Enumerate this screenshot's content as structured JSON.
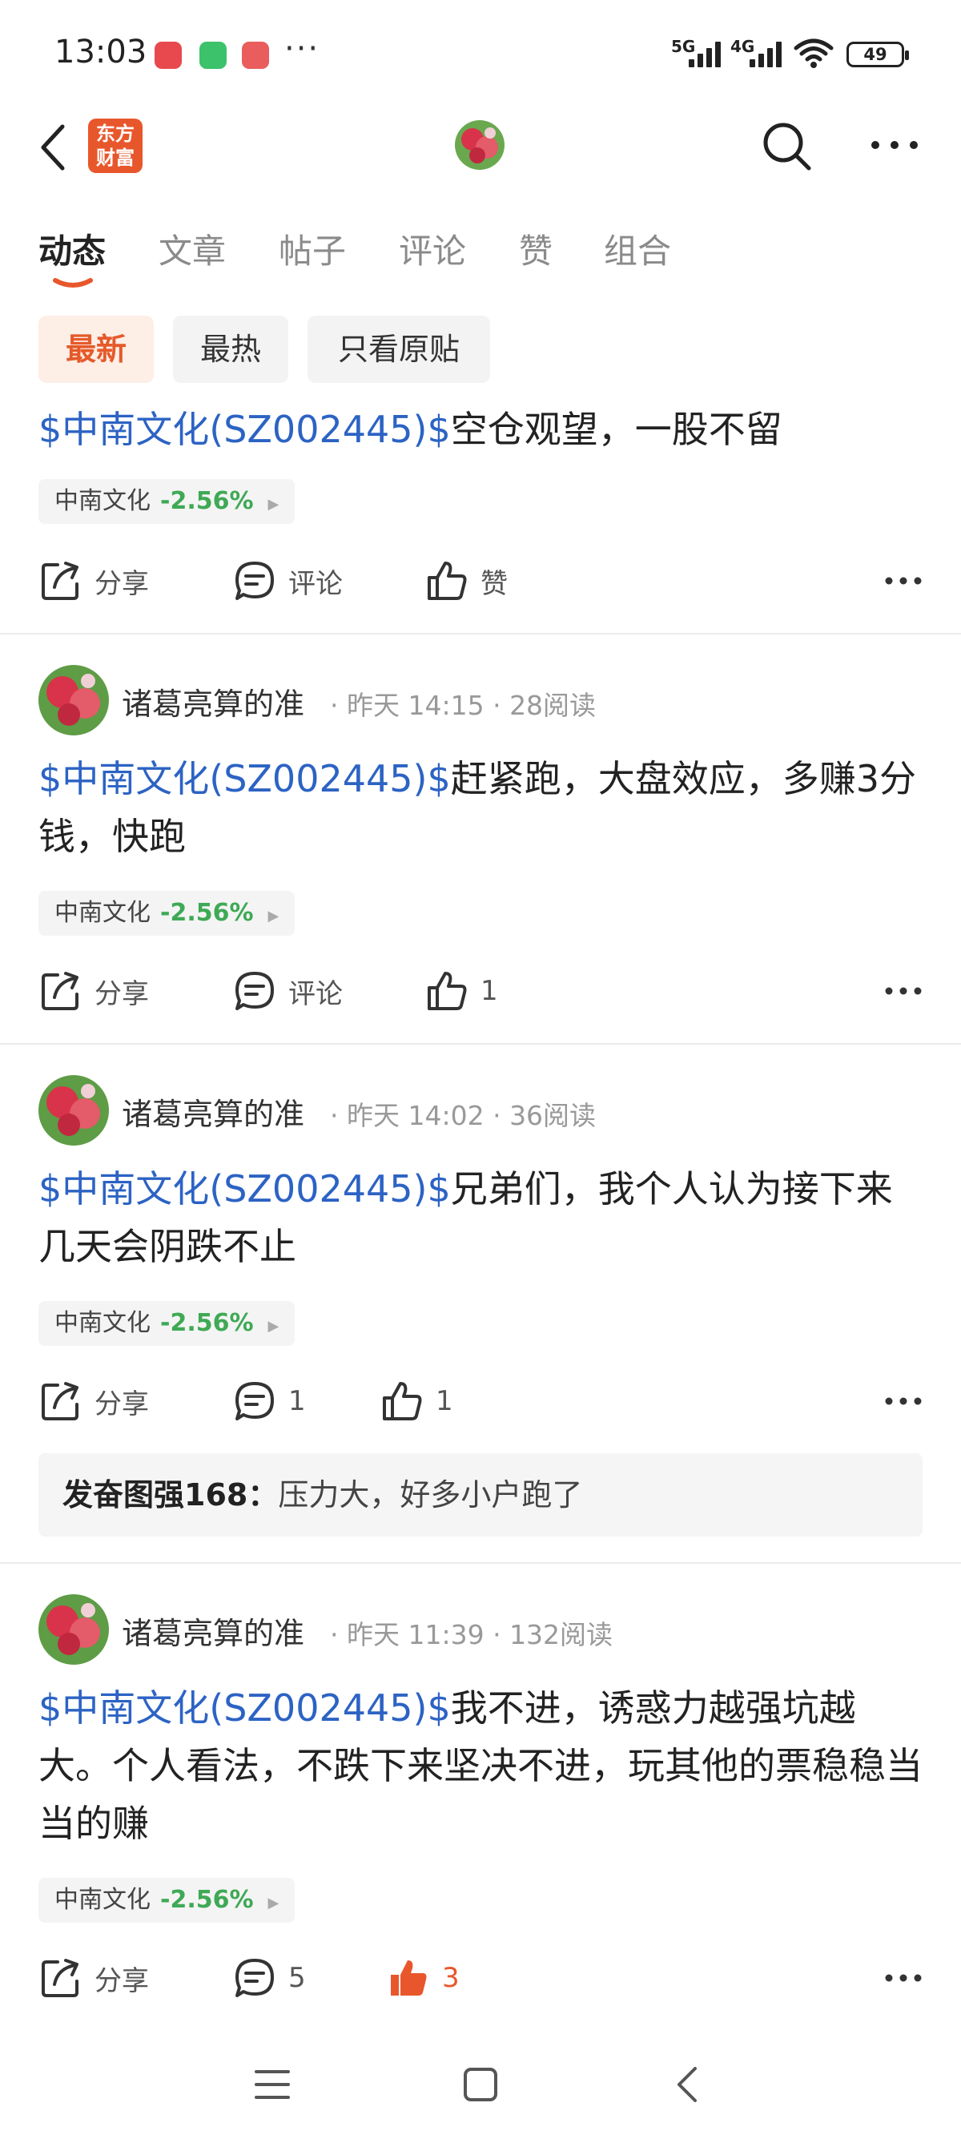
{
  "status_bar": {
    "time": "13:03",
    "more": "···",
    "net1": "5G",
    "net2": "4G",
    "battery": "49"
  },
  "header": {
    "logo_text_line1": "东方",
    "logo_text_line2": "财富",
    "back_icon": "chevron-left-icon",
    "search_icon": "search-icon",
    "more_icon": "more-horizontal-icon"
  },
  "tabs": [
    {
      "label": "动态",
      "active": true
    },
    {
      "label": "文章",
      "active": false
    },
    {
      "label": "帖子",
      "active": false
    },
    {
      "label": "评论",
      "active": false
    },
    {
      "label": "赞",
      "active": false
    },
    {
      "label": "组合",
      "active": false
    }
  ],
  "filters": [
    {
      "label": "最新",
      "active": true
    },
    {
      "label": "最热",
      "active": false
    },
    {
      "label": "只看原贴",
      "active": false
    }
  ],
  "accent_color": "#e8572c",
  "tag_color": "#2c63c4",
  "posts": [
    {
      "tag": "$中南文化(SZ002445)$",
      "text": "空仓观望，一股不留",
      "stock_name": "中南文化",
      "stock_change": "-2.56%",
      "share_label": "分享",
      "comment_label": "评论",
      "like_label": "赞"
    },
    {
      "author": "诸葛亮算的准",
      "time": "昨天 14:15",
      "reads": "28阅读",
      "tag": "$中南文化(SZ002445)$",
      "text": "赶紧跑，大盘效应，多赚3分钱，快跑",
      "stock_name": "中南文化",
      "stock_change": "-2.56%",
      "share_label": "分享",
      "comment_label": "评论",
      "like_label": "1"
    },
    {
      "author": "诸葛亮算的准",
      "time": "昨天 14:02",
      "reads": "36阅读",
      "tag": "$中南文化(SZ002445)$",
      "text": "兄弟们，我个人认为接下来几天会阴跌不止",
      "stock_name": "中南文化",
      "stock_change": "-2.56%",
      "share_label": "分享",
      "comment_label": "1",
      "like_label": "1",
      "reply_author": "发奋图强168：",
      "reply_text": "压力大，好多小户跑了"
    },
    {
      "author": "诸葛亮算的准",
      "time": "昨天 11:39",
      "reads": "132阅读",
      "tag": "$中南文化(SZ002445)$",
      "text": "我不进，诱惑力越强坑越大。个人看法，不跌下来坚决不进，玩其他的票稳稳当当的赚",
      "stock_name": "中南文化",
      "stock_change": "-2.56%",
      "share_label": "分享",
      "comment_label": "5",
      "like_label": "3",
      "liked": true
    }
  ],
  "system_nav": [
    "menu-icon",
    "home-square-icon",
    "back-triangle-icon"
  ]
}
